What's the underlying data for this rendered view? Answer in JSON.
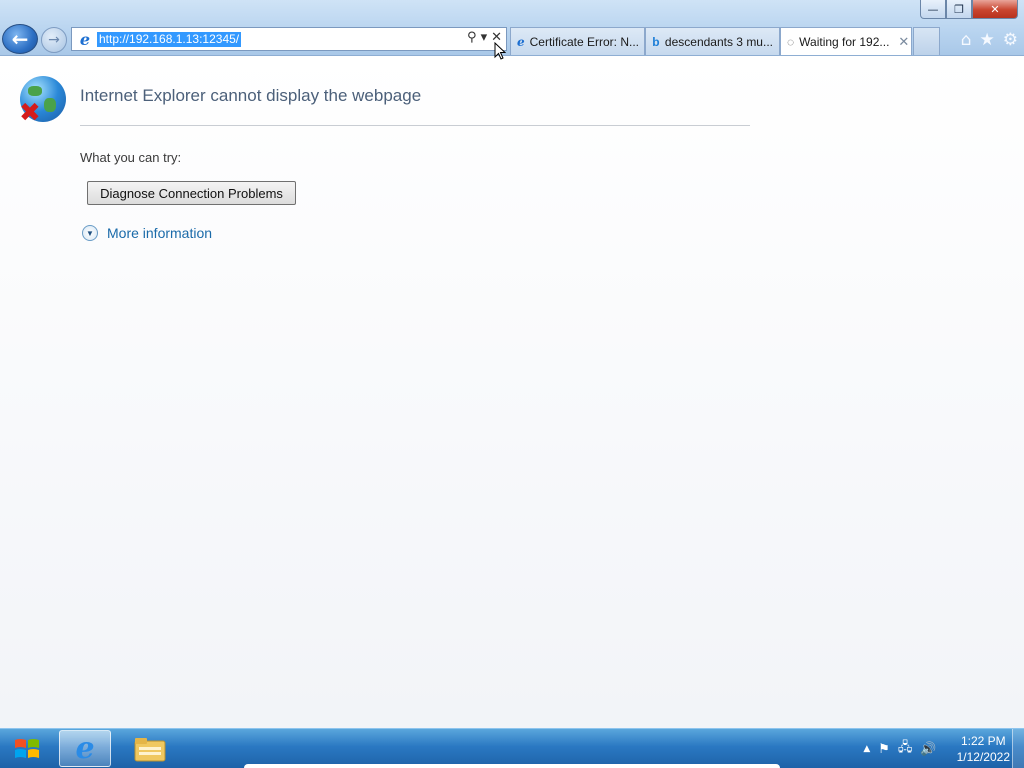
{
  "window": {
    "minimize": "—",
    "restore": "❐",
    "close": "✕"
  },
  "nav": {
    "back_icon": "arrow-left",
    "forward_icon": "arrow-right"
  },
  "address": {
    "url": "http://192.168.1.13:12345/",
    "search_glyph": "⚲",
    "dropdown_glyph": "▾",
    "stop_glyph": "✕"
  },
  "tabs": [
    {
      "label": "Certificate Error: N...",
      "icon": "ie-icon",
      "active": false
    },
    {
      "label": "descendants 3 mu...",
      "icon": "bing-icon",
      "active": false
    },
    {
      "label": "Waiting for 192...",
      "icon": "loading-icon",
      "active": true,
      "close": "✕"
    }
  ],
  "commands": {
    "home": "⌂",
    "favorites": "★",
    "tools": "⚙"
  },
  "error": {
    "title": "Internet Explorer cannot display the webpage",
    "try_label": "What you can try:",
    "diagnose_button": "Diagnose Connection Problems",
    "more_info": "More information"
  },
  "taskbar": {
    "clock_time": "1:22 PM",
    "clock_date": "1/12/2022",
    "tray_up": "▲",
    "colors": {
      "start_red": "#f25022",
      "start_green": "#7fba00",
      "start_blue": "#00a4ef",
      "start_yellow": "#ffb900"
    }
  }
}
